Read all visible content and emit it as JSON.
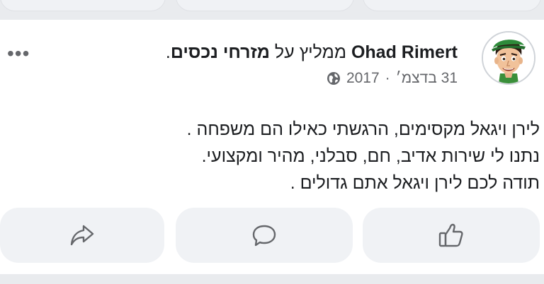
{
  "post": {
    "author": "Ohad Rimert",
    "recommends_text": "ממליץ על",
    "business_name": "מזרחי נכסים",
    "trailing_period": ".",
    "date": "31 בדצמ׳",
    "separator": "·",
    "year": "2017",
    "privacy_icon": "globe-icon",
    "more_icon": "more-options-icon",
    "more_text": "•••",
    "body_lines": [
      "לירן ויגאל מקסימים, הרגשתי כאילו הם משפחה .",
      "נתנו לי שירות אדיב, חם, סבלני, מהיר ומקצועי.",
      "תודה לכם לירן ויגאל אתם גדולים ."
    ]
  },
  "actions": {
    "like_icon": "thumbs-up-icon",
    "comment_icon": "comment-icon",
    "share_icon": "share-icon"
  },
  "colors": {
    "background": "#e9ebee",
    "card": "#ffffff",
    "button": "#f0f2f5",
    "text": "#1c1e21",
    "muted": "#65676b"
  }
}
